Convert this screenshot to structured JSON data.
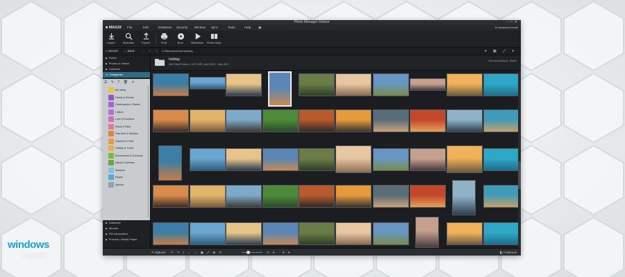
{
  "window": {
    "title": "Photo Manager Deluxe"
  },
  "menubar": {
    "logo": "■ MAGIX",
    "items": [
      "File",
      "Edit",
      "Database",
      "Security",
      "Window",
      "Sync",
      "Tools",
      "Help"
    ],
    "advanced_mode": "Advanced mode"
  },
  "toolbar": [
    {
      "label": "Import",
      "icon": "download-icon"
    },
    {
      "label": "Selection",
      "icon": "search-icon"
    },
    {
      "label": "Export",
      "icon": "upload-icon"
    },
    {
      "label": "Print",
      "icon": "printer-icon"
    },
    {
      "label": "Burn",
      "icon": "disc-icon"
    },
    {
      "label": "Slideshow",
      "icon": "play-icon"
    },
    {
      "label": "Photo book",
      "icon": "book-icon"
    }
  ],
  "nav": {
    "search": "Search",
    "back": "Back",
    "path": "C:\\Benutzer\\User\\holiday"
  },
  "sidebar": {
    "sections": [
      "Folder",
      "Photos & Videos",
      "Calendar",
      "Categories"
    ],
    "active_section": "Categories",
    "categories": [
      {
        "label": "My rating",
        "color": "#f0c23a"
      },
      {
        "label": "Family & Friends",
        "color": "#8e57c4"
      },
      {
        "label": "Celebrations & Parties",
        "color": "#a665d1"
      },
      {
        "label": "Culture",
        "color": "#b071d6"
      },
      {
        "label": "Love & Emotions",
        "color": "#d06fb8"
      },
      {
        "label": "Music & Party",
        "color": "#e07aa2"
      },
      {
        "label": "Free time & Hobbies",
        "color": "#d7883a"
      },
      {
        "label": "Careers & Clubs",
        "color": "#e59a45"
      },
      {
        "label": "Holiday & Travel",
        "color": "#e8ac4c"
      },
      {
        "label": "Environment & Economy",
        "color": "#7fb54b"
      },
      {
        "label": "Nature & Animals",
        "color": "#6aa83f"
      },
      {
        "label": "Seasons",
        "color": "#7ec4d8"
      },
      {
        "label": "People",
        "color": "#5aa8d0"
      },
      {
        "label": "Special",
        "color": "#9aa0a5"
      }
    ],
    "bottom_sections": [
      "Database",
      "Albums",
      "File information",
      "Preview / Media Player"
    ]
  },
  "album": {
    "name": "holiday",
    "meta": "380 Files/Folders | 1475 MB | April 2005 - May 2017",
    "sort": "Sort according to: Name"
  },
  "bottombar": {
    "options": "Options",
    "fotobook": "Fotobook"
  },
  "watermark": {
    "line1": "windows",
    "line2": "report"
  },
  "thumbnails": [
    {
      "row": 0,
      "colors": [
        "#3b7fa6",
        "#c97c44"
      ]
    },
    {
      "row": 0,
      "colors": [
        "#6aa6cf",
        "#2d5d7c"
      ]
    },
    {
      "row": 0,
      "colors": [
        "#e7c48a",
        "#2c3d4f"
      ]
    },
    {
      "row": 0,
      "colors": [
        "#5b86b6",
        "#c48a54"
      ],
      "selected": true
    },
    {
      "row": 0,
      "colors": [
        "#6c7c48",
        "#2d3f25"
      ]
    },
    {
      "row": 0,
      "colors": [
        "#e7c7a2",
        "#8d6c54"
      ]
    },
    {
      "row": 0,
      "colors": [
        "#6796c2",
        "#7a8c4a"
      ]
    },
    {
      "row": 0,
      "colors": [
        "#c6a08e",
        "#4a3a40"
      ]
    },
    {
      "row": 0,
      "colors": [
        "#f0b15a",
        "#6a5a3e"
      ]
    },
    {
      "row": 0,
      "colors": [
        "#2fa7c6",
        "#1e6e8c"
      ]
    }
  ]
}
